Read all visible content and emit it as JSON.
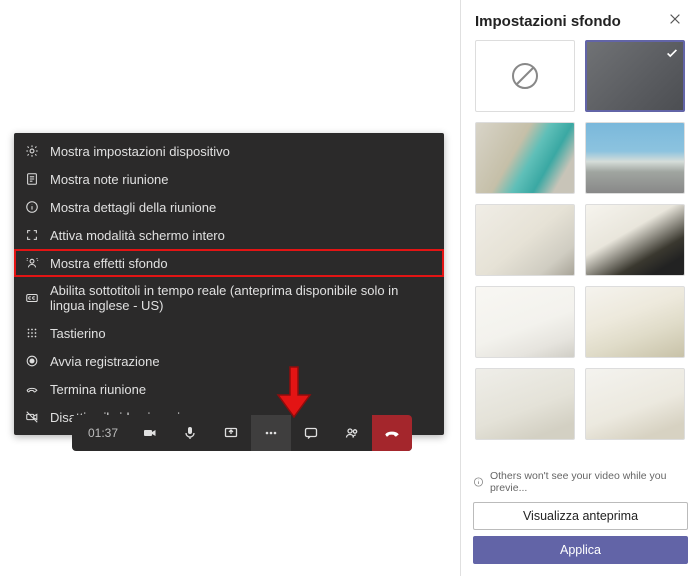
{
  "menu": {
    "items": [
      "Mostra impostazioni dispositivo",
      "Mostra note riunione",
      "Mostra dettagli della riunione",
      "Attiva modalità schermo intero",
      "Mostra effetti sfondo",
      "Abilita sottotitoli in tempo reale (anteprima disponibile solo in lingua inglese - US)",
      "Tastierino",
      "Avvia registrazione",
      "Termina riunione",
      "Disattiva il video in arrivo"
    ],
    "highlighted_index": 4
  },
  "toolbar": {
    "time": "01:37"
  },
  "panel": {
    "title": "Impostazioni sfondo",
    "note": "Others won't see your video while you previe...",
    "preview_button": "Visualizza anteprima",
    "apply_button": "Applica",
    "selected_index": 1
  }
}
